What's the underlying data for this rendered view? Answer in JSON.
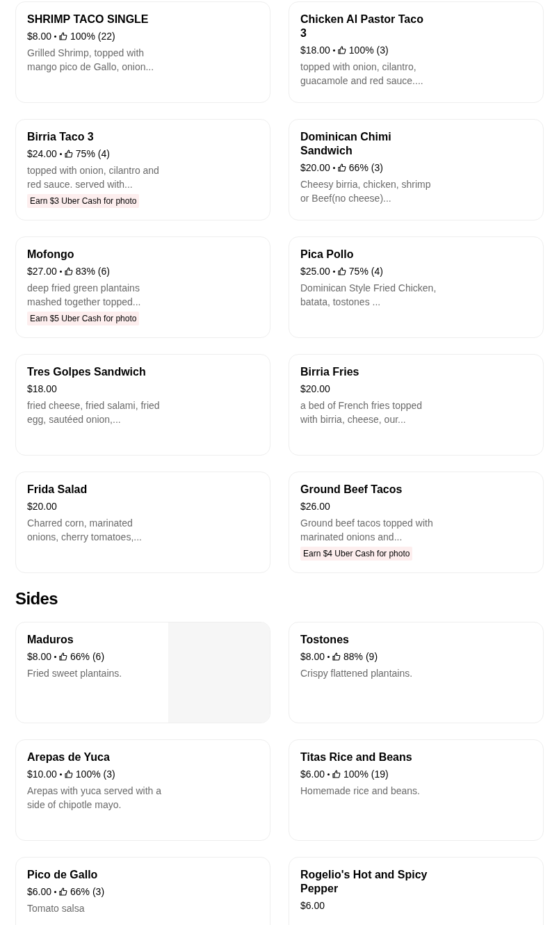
{
  "sections": [
    {
      "items": [
        {
          "name": "SHRIMP TACO SINGLE",
          "price": "$8.00",
          "rating": "100% (22)",
          "description": "Grilled Shrimp, topped with mango pico de Gallo, onion..."
        },
        {
          "name": "Chicken Al Pastor Taco 3",
          "price": "$18.00",
          "rating": "100% (3)",
          "description": "topped with onion, cilantro, guacamole and red sauce...."
        },
        {
          "name": "Birria Taco 3",
          "price": "$24.00",
          "rating": "75% (4)",
          "description": "topped with onion, cilantro and red sauce. served with...",
          "promo": "Earn $3 Uber Cash for photo"
        },
        {
          "name": "Dominican Chimi Sandwich",
          "price": "$20.00",
          "rating": "66% (3)",
          "description": "Cheesy birria, chicken, shrimp or Beef(no cheese)..."
        },
        {
          "name": "Mofongo",
          "price": "$27.00",
          "rating": "83% (6)",
          "description": "deep fried green plantains mashed together topped...",
          "promo": "Earn $5 Uber Cash for photo"
        },
        {
          "name": "Pica Pollo",
          "price": "$25.00",
          "rating": "75% (4)",
          "description": "Dominican Style Fried Chicken, batata, tostones ..."
        },
        {
          "name": "Tres Golpes Sandwich",
          "price": "$18.00",
          "description": "fried cheese, fried salami, fried egg, sautéed onion,..."
        },
        {
          "name": "Birria Fries",
          "price": "$20.00",
          "description": "a bed of French fries topped with birria, cheese, our..."
        },
        {
          "name": "Frida Salad",
          "price": "$20.00",
          "description": "Charred corn, marinated onions, cherry tomatoes,..."
        },
        {
          "name": "Ground Beef Tacos",
          "price": "$26.00",
          "description": "Ground beef tacos topped with marinated onions and...",
          "promo": "Earn $4 Uber Cash for photo"
        }
      ]
    },
    {
      "heading": "Sides",
      "items": [
        {
          "name": "Maduros",
          "price": "$8.00",
          "rating": "66% (6)",
          "description": "Fried sweet plantains.",
          "kind": "image"
        },
        {
          "name": "Tostones",
          "price": "$8.00",
          "rating": "88% (9)",
          "description": "Crispy flattened plantains.",
          "kind": "text"
        },
        {
          "name": "Arepas de Yuca",
          "price": "$10.00",
          "rating": "100% (3)",
          "description": "Arepas with yuca served with a side of chipotle mayo."
        },
        {
          "name": "Titas Rice and Beans",
          "price": "$6.00",
          "rating": "100% (19)",
          "description": "Homemade rice and beans."
        },
        {
          "name": "Pico de Gallo",
          "price": "$6.00",
          "rating": "66% (3)",
          "description": "Tomato salsa"
        },
        {
          "name": "Rogelio's Hot and Spicy Pepper",
          "price": "$6.00"
        }
      ]
    }
  ]
}
